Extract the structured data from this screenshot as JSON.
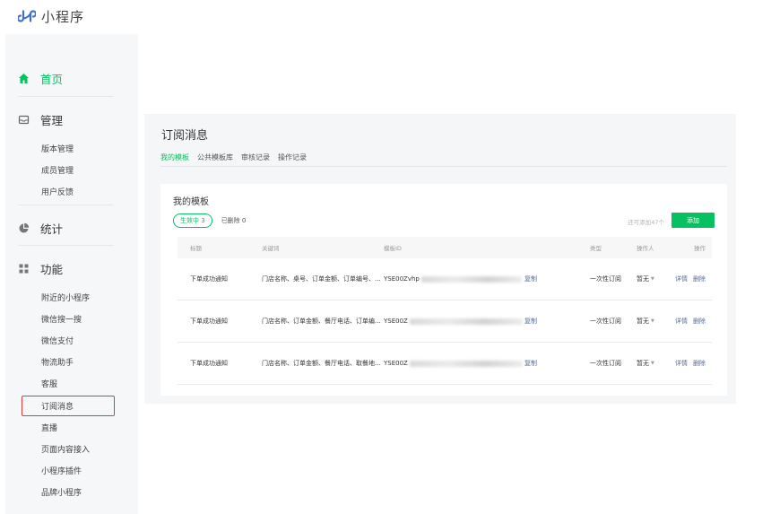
{
  "brand": {
    "name": "小程序",
    "logo_color": "#3f6fd4"
  },
  "sidebar": {
    "home": {
      "label": "首页",
      "icon": "home-icon"
    },
    "manage": {
      "label": "管理",
      "icon": "manage-icon",
      "items": [
        "版本管理",
        "成员管理",
        "用户反馈"
      ]
    },
    "stats": {
      "label": "统计",
      "icon": "pie-chart-icon"
    },
    "features": {
      "label": "功能",
      "icon": "grid-icon",
      "items": [
        "附近的小程序",
        "微信搜一搜",
        "微信支付",
        "物流助手",
        "客服",
        "订阅消息",
        "直播",
        "页面内容接入",
        "小程序插件",
        "品牌小程序"
      ]
    }
  },
  "main": {
    "title": "订阅消息",
    "tabs": [
      "我的模板",
      "公共模板库",
      "审核记录",
      "操作记录"
    ],
    "panel": {
      "title": "我的模板",
      "filter_active": "生效中 3",
      "filter_deleted": "已删除 0",
      "remaining": "还可添加47个",
      "add_label": "添加"
    },
    "table": {
      "headers": [
        "标题",
        "关键词",
        "模板ID",
        "类型",
        "操作人",
        "操作"
      ],
      "rows": [
        {
          "title": "下单成功通知",
          "keywords": "门店名称、桌号、订单金额、订单编号、...",
          "template_id": "YSE00Zvhp",
          "copy": "复制",
          "type": "一次性订阅",
          "operator": "暂无",
          "detail": "详情",
          "delete": "删除"
        },
        {
          "title": "下单成功通知",
          "keywords": "门店名称、订单金额、餐厅电话、订单编...",
          "template_id": "YSE00Z",
          "copy": "复制",
          "type": "一次性订阅",
          "operator": "暂无",
          "detail": "详情",
          "delete": "删除"
        },
        {
          "title": "下单成功通知",
          "keywords": "门店名称、订单金额、餐厅电话、取餐地...",
          "template_id": "YSE00Z",
          "copy": "复制",
          "type": "一次性订阅",
          "operator": "暂无",
          "detail": "详情",
          "delete": "删除"
        }
      ]
    }
  },
  "colors": {
    "accent": "#07c160",
    "link": "#576b95",
    "highlight": "#e03b3b"
  }
}
